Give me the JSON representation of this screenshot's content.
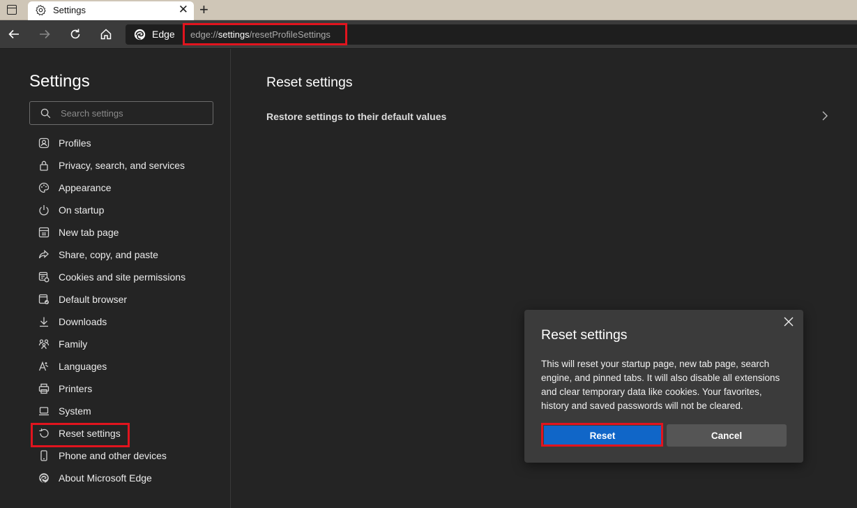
{
  "browser": {
    "tab_title": "Settings",
    "brand": "Edge",
    "url_scheme": "edge://",
    "url_host": "settings",
    "url_path": "/resetProfileSettings"
  },
  "sidebar": {
    "title": "Settings",
    "search_placeholder": "Search settings",
    "items": [
      {
        "label": "Profiles",
        "icon": "profile-icon"
      },
      {
        "label": "Privacy, search, and services",
        "icon": "lock-icon"
      },
      {
        "label": "Appearance",
        "icon": "palette-icon"
      },
      {
        "label": "On startup",
        "icon": "power-icon"
      },
      {
        "label": "New tab page",
        "icon": "grid-icon"
      },
      {
        "label": "Share, copy, and paste",
        "icon": "share-icon"
      },
      {
        "label": "Cookies and site permissions",
        "icon": "permissions-icon"
      },
      {
        "label": "Default browser",
        "icon": "browser-icon"
      },
      {
        "label": "Downloads",
        "icon": "download-icon"
      },
      {
        "label": "Family",
        "icon": "family-icon"
      },
      {
        "label": "Languages",
        "icon": "language-icon"
      },
      {
        "label": "Printers",
        "icon": "printer-icon"
      },
      {
        "label": "System",
        "icon": "laptop-icon"
      },
      {
        "label": "Reset settings",
        "icon": "reset-icon"
      },
      {
        "label": "Phone and other devices",
        "icon": "phone-icon"
      },
      {
        "label": "About Microsoft Edge",
        "icon": "edge-icon"
      }
    ]
  },
  "main": {
    "title": "Reset settings",
    "restore_label": "Restore settings to their default values"
  },
  "dialog": {
    "title": "Reset settings",
    "body": "This will reset your startup page, new tab page, search engine, and pinned tabs. It will also disable all extensions and clear temporary data like cookies. Your favorites, history and saved passwords will not be cleared.",
    "reset_label": "Reset",
    "cancel_label": "Cancel"
  },
  "colors": {
    "highlight": "#e1141e",
    "accent": "#1066c8"
  }
}
